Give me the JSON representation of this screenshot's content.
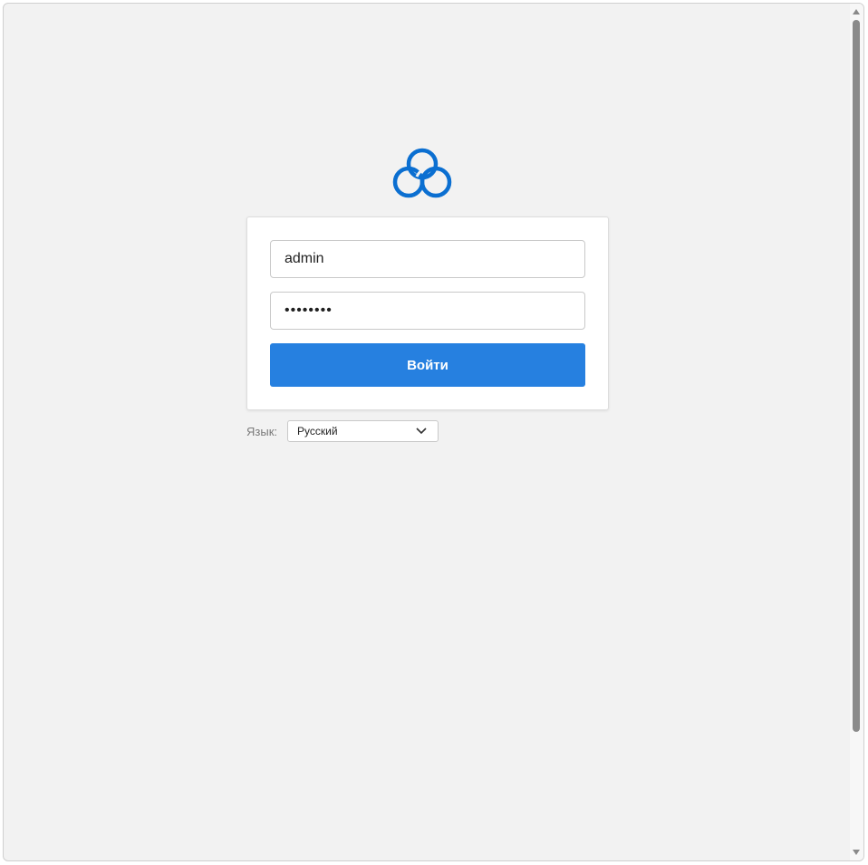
{
  "login": {
    "username_value": "admin",
    "password_masked": "••••••••",
    "submit_label": "Войти"
  },
  "language": {
    "label": "Язык:",
    "selected": "Русский"
  },
  "icons": {
    "logo": "cloud-logo-icon",
    "dropdown": "chevron-down-icon",
    "scroll_up": "scroll-up-icon",
    "scroll_down": "scroll-down-icon"
  },
  "colors": {
    "brand": "#0b6fd1",
    "button": "#2680e0",
    "background": "#f2f2f2"
  }
}
